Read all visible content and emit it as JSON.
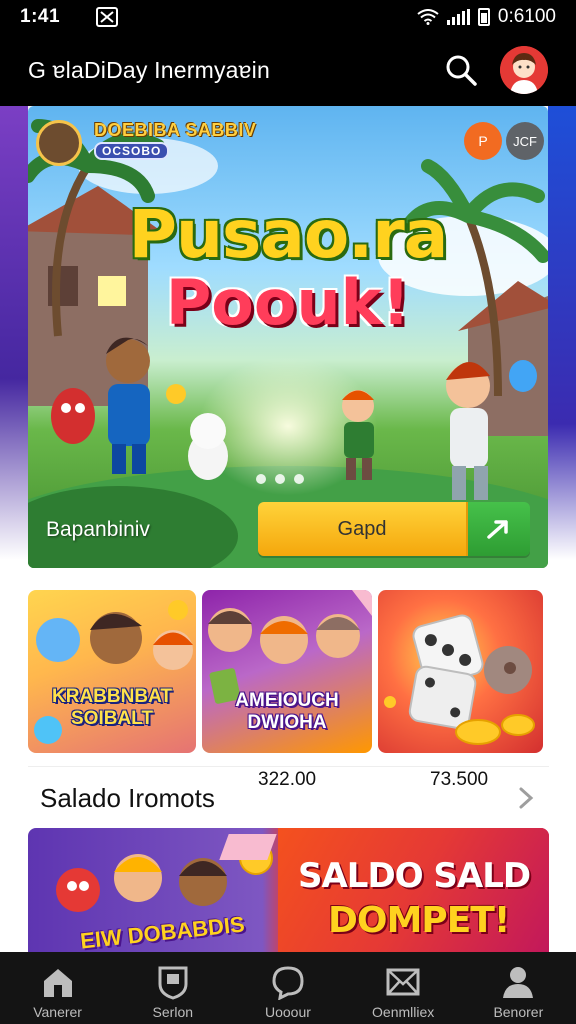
{
  "status_bar": {
    "time": "1:41",
    "clock": "0:6100"
  },
  "app_bar": {
    "title": "G ɐlaDiDay Inermyaɐin"
  },
  "hero": {
    "profile_name": "DOEBIBA SABBIV",
    "profile_tag": "OCSOBO",
    "chip_orange": "P",
    "chip_gray": "JCF",
    "title_line1": "Pusao.ra",
    "title_line2": "Poouk!",
    "caption": "Bapanbiniv",
    "cta_label": "Gapd",
    "carousel_dots": 3
  },
  "tiles": [
    {
      "label": "KRABBNBAT SOIBALT"
    },
    {
      "label": "AMEIOUCH DWIOHA"
    },
    {
      "label": ""
    }
  ],
  "wallet": {
    "label": "Salado Iromots",
    "amount1": "322.00",
    "amount2": "73.500"
  },
  "promo": {
    "line1": "SALDO SALD",
    "line2": "DOMPET!",
    "left_label": "EIW DOBABDIS"
  },
  "bottom_nav": [
    {
      "label": "Vanerer",
      "icon": "home-icon"
    },
    {
      "label": "Serlon",
      "icon": "shield-icon"
    },
    {
      "label": "Uooour",
      "icon": "chat-icon"
    },
    {
      "label": "Oenmlliex",
      "icon": "mail-icon"
    },
    {
      "label": "Benorer",
      "icon": "profile-icon"
    }
  ],
  "colors": {
    "app_bar_bg": "#000000",
    "cta_yellow": "#ffc21f",
    "cta_green": "#3cb043",
    "avatar_red": "#e53935",
    "nav_bg": "#141414"
  }
}
